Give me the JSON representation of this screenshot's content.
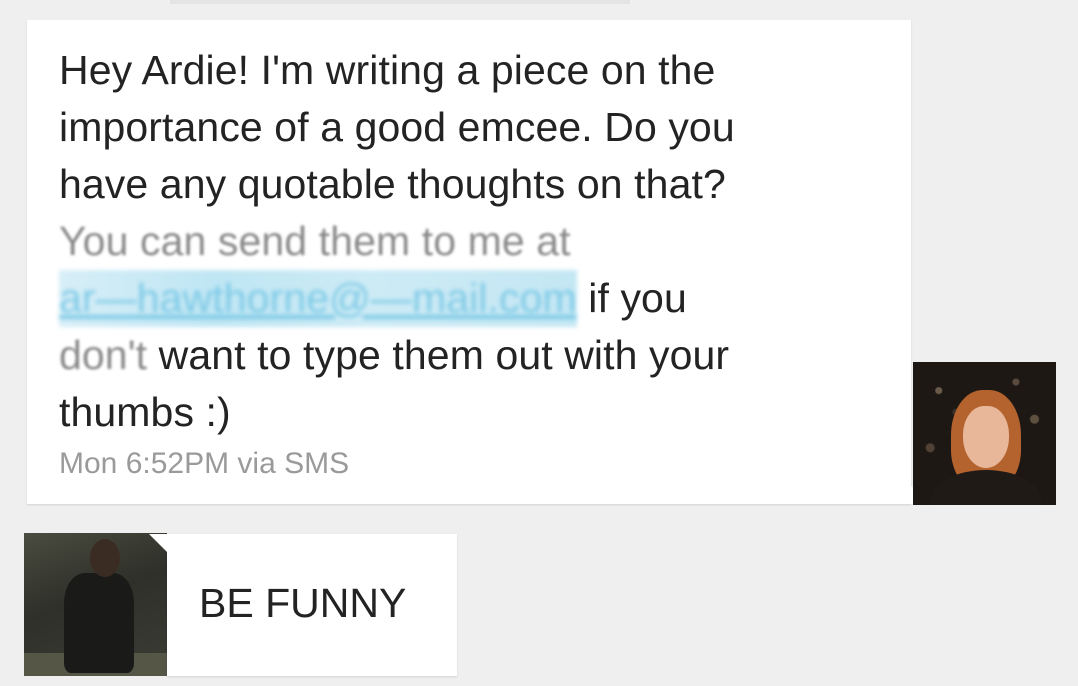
{
  "conversation": {
    "incoming": {
      "lines": [
        "Hey Ardie! I'm writing a piece on the",
        "importance of a good emcee. Do you",
        "have any quotable thoughts on that?",
        "You can send them to me at"
      ],
      "email_redacted": "ar—hawthorne@—mail.com",
      "after_email": " if you",
      "line6_faded": "don't",
      "line6_rest": " want to type them out with your",
      "line7": "thumbs :)",
      "timestamp": "Mon 6:52PM via SMS",
      "avatar_icon": "contact-avatar-woman"
    },
    "outgoing": {
      "text": "BE FUNNY",
      "avatar_icon": "contact-avatar-man"
    }
  },
  "colors": {
    "background": "#efefef",
    "bubble": "#ffffff",
    "text": "#232323",
    "timestamp": "#9a9a9a",
    "link": "#7cc9e6"
  }
}
